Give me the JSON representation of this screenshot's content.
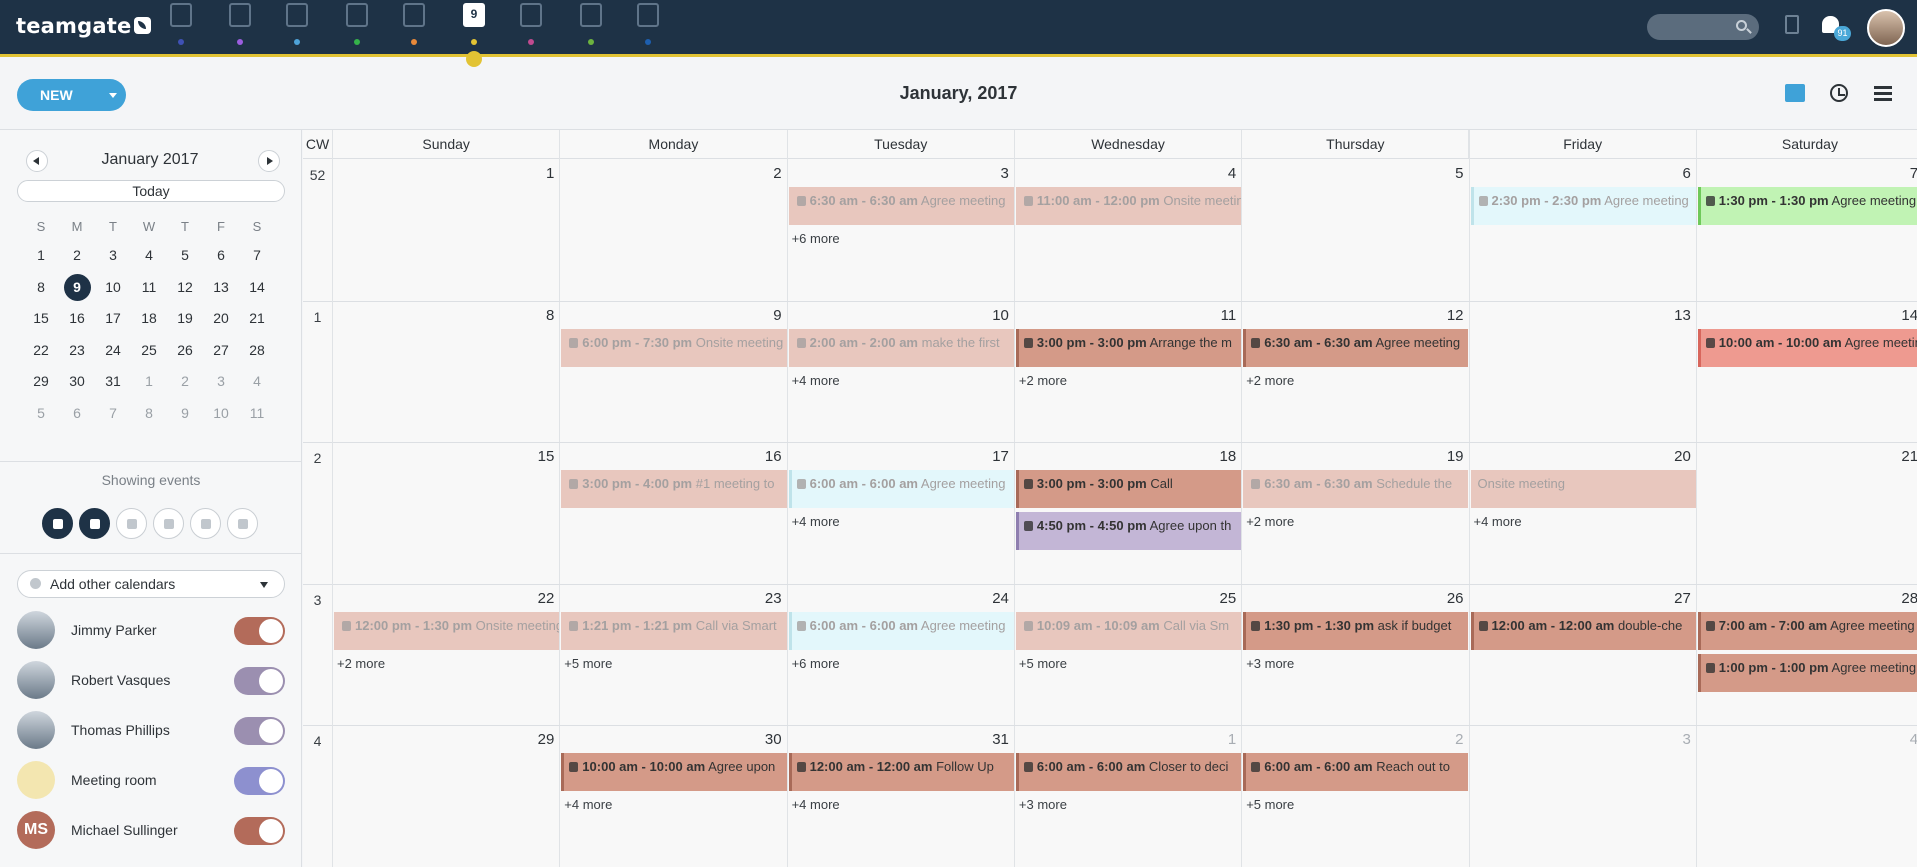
{
  "header": {
    "logo": "teamgate",
    "nav_items": [
      {
        "icon": "dashboard-icon",
        "dot": "#3f51b5"
      },
      {
        "icon": "target-icon",
        "dot": "#9c5ee0"
      },
      {
        "icon": "building-icon",
        "dot": "#4ea3d9"
      },
      {
        "icon": "person-icon",
        "dot": "#35b34a"
      },
      {
        "icon": "briefcase-icon",
        "dot": "#e8893a"
      },
      {
        "icon": "calendar-icon",
        "dot": "#e2c334",
        "label": "9"
      },
      {
        "icon": "inbox-icon",
        "dot": "#c04a8f"
      },
      {
        "icon": "clipboard-icon",
        "dot": "#6cb33f"
      },
      {
        "icon": "chart-icon",
        "dot": "#1d5fb0"
      }
    ],
    "notification_count": "91"
  },
  "toolbar": {
    "new_label": "NEW",
    "title": "January, 2017"
  },
  "mini_calendar": {
    "title": "January 2017",
    "today_label": "Today",
    "dow": [
      "S",
      "M",
      "T",
      "W",
      "T",
      "F",
      "S"
    ],
    "days": [
      [
        "1",
        "2",
        "3",
        "4",
        "5",
        "6",
        "7"
      ],
      [
        "8",
        "9",
        "10",
        "11",
        "12",
        "13",
        "14"
      ],
      [
        "15",
        "16",
        "17",
        "18",
        "19",
        "20",
        "21"
      ],
      [
        "22",
        "23",
        "24",
        "25",
        "26",
        "27",
        "28"
      ],
      [
        "29",
        "30",
        "31",
        "1",
        "2",
        "3",
        "4"
      ],
      [
        "5",
        "6",
        "7",
        "8",
        "9",
        "10",
        "11"
      ]
    ],
    "selected": "9"
  },
  "sidebar": {
    "showing_label": "Showing events",
    "add_calendars_label": "Add other calendars",
    "people": [
      {
        "name": "Jimmy Parker",
        "toggle": "#b36b5a",
        "initials": ""
      },
      {
        "name": "Robert Vasques",
        "toggle": "#9b8fb0",
        "initials": ""
      },
      {
        "name": "Thomas Phillips",
        "toggle": "#9b8fb0",
        "initials": ""
      },
      {
        "name": "Meeting room",
        "toggle": "#8d90cf",
        "initials": ""
      },
      {
        "name": "Michael Sullinger",
        "toggle": "#b36b5a",
        "initials": "MS"
      }
    ]
  },
  "grid": {
    "cw_label": "CW",
    "weekdays": [
      "Sunday",
      "Monday",
      "Tuesday",
      "Wednesday",
      "Thursday",
      "Friday",
      "Saturday"
    ],
    "weeks": [
      {
        "cw": "52",
        "days": [
          {
            "n": "1"
          },
          {
            "n": "2"
          },
          {
            "n": "3",
            "events": [
              {
                "t": "6:30 am - 6:30 am",
                "d": "Agree meeting",
                "c": "#e8c7be",
                "f": true,
                "ic": "phone"
              }
            ],
            "more": "+6 more"
          },
          {
            "n": "4",
            "events": [
              {
                "t": "11:00 am - 12:00 pm",
                "d": "Onsite meeting",
                "c": "#e8c7be",
                "f": true,
                "ic": "cal"
              }
            ]
          },
          {
            "n": "5"
          },
          {
            "n": "6",
            "events": [
              {
                "t": "2:30 pm - 2:30 pm",
                "d": "Agree meeting",
                "c": "#e3f7fb",
                "f": true,
                "ic": "phone",
                "b": "#bfe3ea"
              }
            ]
          },
          {
            "n": "7",
            "events": [
              {
                "t": "1:30 pm - 1:30 pm",
                "d": "Agree meeting",
                "c": "#c1f3b4",
                "f": false,
                "ic": "phone",
                "b": "#6fc95a"
              }
            ]
          }
        ]
      },
      {
        "cw": "1",
        "days": [
          {
            "n": "8"
          },
          {
            "n": "9",
            "events": [
              {
                "t": "6:00 pm - 7:30 pm",
                "d": "Onsite meeting",
                "c": "#e8c7be",
                "f": true,
                "ic": "cal"
              }
            ]
          },
          {
            "n": "10",
            "events": [
              {
                "t": "2:00 am - 2:00 am",
                "d": "make the first",
                "c": "#e8c7be",
                "f": true,
                "ic": "phone"
              }
            ],
            "more": "+4 more"
          },
          {
            "n": "11",
            "events": [
              {
                "t": "3:00 pm - 3:00 pm",
                "d": "Arrange the m",
                "c": "#d49a88",
                "f": false,
                "ic": "phone",
                "b": "#a86a58"
              }
            ],
            "more": "+2 more"
          },
          {
            "n": "12",
            "events": [
              {
                "t": "6:30 am - 6:30 am",
                "d": "Agree meeting",
                "c": "#d49a88",
                "f": false,
                "ic": "phone",
                "b": "#a86a58"
              }
            ],
            "more": "+2 more"
          },
          {
            "n": "13"
          },
          {
            "n": "14",
            "events": [
              {
                "t": "10:00 am - 10:00 am",
                "d": "Agree meeting",
                "c": "#ee9a90",
                "f": false,
                "ic": "phone",
                "b": "#d8665c"
              }
            ]
          }
        ]
      },
      {
        "cw": "2",
        "days": [
          {
            "n": "15"
          },
          {
            "n": "16",
            "events": [
              {
                "t": "3:00 pm - 4:00 pm",
                "d": "#1 meeting to",
                "c": "#e8c7be",
                "f": true,
                "ic": "cal"
              }
            ]
          },
          {
            "n": "17",
            "events": [
              {
                "t": "6:00 am - 6:00 am",
                "d": "Agree meeting",
                "c": "#e3f7fb",
                "f": true,
                "ic": "phone",
                "b": "#bfe3ea"
              }
            ],
            "more": "+4 more"
          },
          {
            "n": "18",
            "events": [
              {
                "t": "3:00 pm - 3:00 pm",
                "d": "Call",
                "c": "#d49a88",
                "f": false,
                "ic": "phone",
                "b": "#a86a58"
              },
              {
                "t": "4:50 pm - 4:50 pm",
                "d": "Agree upon th",
                "c": "#c3b6d6",
                "f": false,
                "ic": "phone",
                "b": "#8f7fb0"
              }
            ]
          },
          {
            "n": "19",
            "events": [
              {
                "t": "6:30 am - 6:30 am",
                "d": "Schedule the",
                "c": "#e8c7be",
                "f": true,
                "ic": "phone"
              }
            ],
            "more": "+2 more"
          },
          {
            "n": "20",
            "events": [
              {
                "t": "",
                "d": "Onsite meeting",
                "c": "#e8c7be",
                "f": true,
                "ic": "none"
              }
            ],
            "more": "+4 more"
          },
          {
            "n": "21"
          }
        ]
      },
      {
        "cw": "3",
        "days": [
          {
            "n": "22",
            "events": [
              {
                "t": "12:00 pm - 1:30 pm",
                "d": "Onsite meeting",
                "c": "#e8c7be",
                "f": true,
                "ic": "cal"
              }
            ],
            "more": "+2 more"
          },
          {
            "n": "23",
            "events": [
              {
                "t": "1:21 pm - 1:21 pm",
                "d": "Call via Smart",
                "c": "#e8c7be",
                "f": true,
                "ic": "phone"
              }
            ],
            "more": "+5 more"
          },
          {
            "n": "24",
            "events": [
              {
                "t": "6:00 am - 6:00 am",
                "d": "Agree meeting",
                "c": "#e3f7fb",
                "f": true,
                "ic": "phone",
                "b": "#bfe3ea"
              }
            ],
            "more": "+6 more"
          },
          {
            "n": "25",
            "events": [
              {
                "t": "10:09 am - 10:09 am",
                "d": "Call via Sm",
                "c": "#e8c7be",
                "f": true,
                "ic": "phone"
              }
            ],
            "more": "+5 more"
          },
          {
            "n": "26",
            "events": [
              {
                "t": "1:30 pm - 1:30 pm",
                "d": "ask if budget",
                "c": "#d49a88",
                "f": false,
                "ic": "phone",
                "b": "#a86a58"
              }
            ],
            "more": "+3 more"
          },
          {
            "n": "27",
            "events": [
              {
                "t": "12:00 am - 12:00 am",
                "d": "double-che",
                "c": "#d49a88",
                "f": false,
                "ic": "phone",
                "b": "#a86a58"
              }
            ]
          },
          {
            "n": "28",
            "events": [
              {
                "t": "7:00 am - 7:00 am",
                "d": "Agree meeting",
                "c": "#d49a88",
                "f": false,
                "ic": "phone",
                "b": "#a86a58"
              },
              {
                "t": "1:00 pm - 1:00 pm",
                "d": "Agree meeting",
                "c": "#d49a88",
                "f": false,
                "ic": "phone",
                "b": "#a86a58"
              }
            ]
          }
        ]
      },
      {
        "cw": "4",
        "days": [
          {
            "n": "29"
          },
          {
            "n": "30",
            "events": [
              {
                "t": "10:00 am - 10:00 am",
                "d": "Agree upon",
                "c": "#d49a88",
                "f": false,
                "ic": "phone",
                "b": "#a86a58"
              }
            ],
            "more": "+4 more"
          },
          {
            "n": "31",
            "events": [
              {
                "t": "12:00 am - 12:00 am",
                "d": "Follow Up",
                "c": "#d49a88",
                "f": false,
                "ic": "phone",
                "b": "#a86a58"
              }
            ],
            "more": "+4 more"
          },
          {
            "n": "1",
            "dim": true,
            "events": [
              {
                "t": "6:00 am - 6:00 am",
                "d": "Closer to deci",
                "c": "#d49a88",
                "f": false,
                "ic": "phone",
                "b": "#a86a58"
              }
            ],
            "more": "+3 more"
          },
          {
            "n": "2",
            "dim": true,
            "events": [
              {
                "t": "6:00 am - 6:00 am",
                "d": "Reach out to",
                "c": "#d49a88",
                "f": false,
                "ic": "phone",
                "b": "#a86a58"
              }
            ],
            "more": "+5 more"
          },
          {
            "n": "3",
            "dim": true
          },
          {
            "n": "4",
            "dim": true
          }
        ]
      }
    ]
  }
}
